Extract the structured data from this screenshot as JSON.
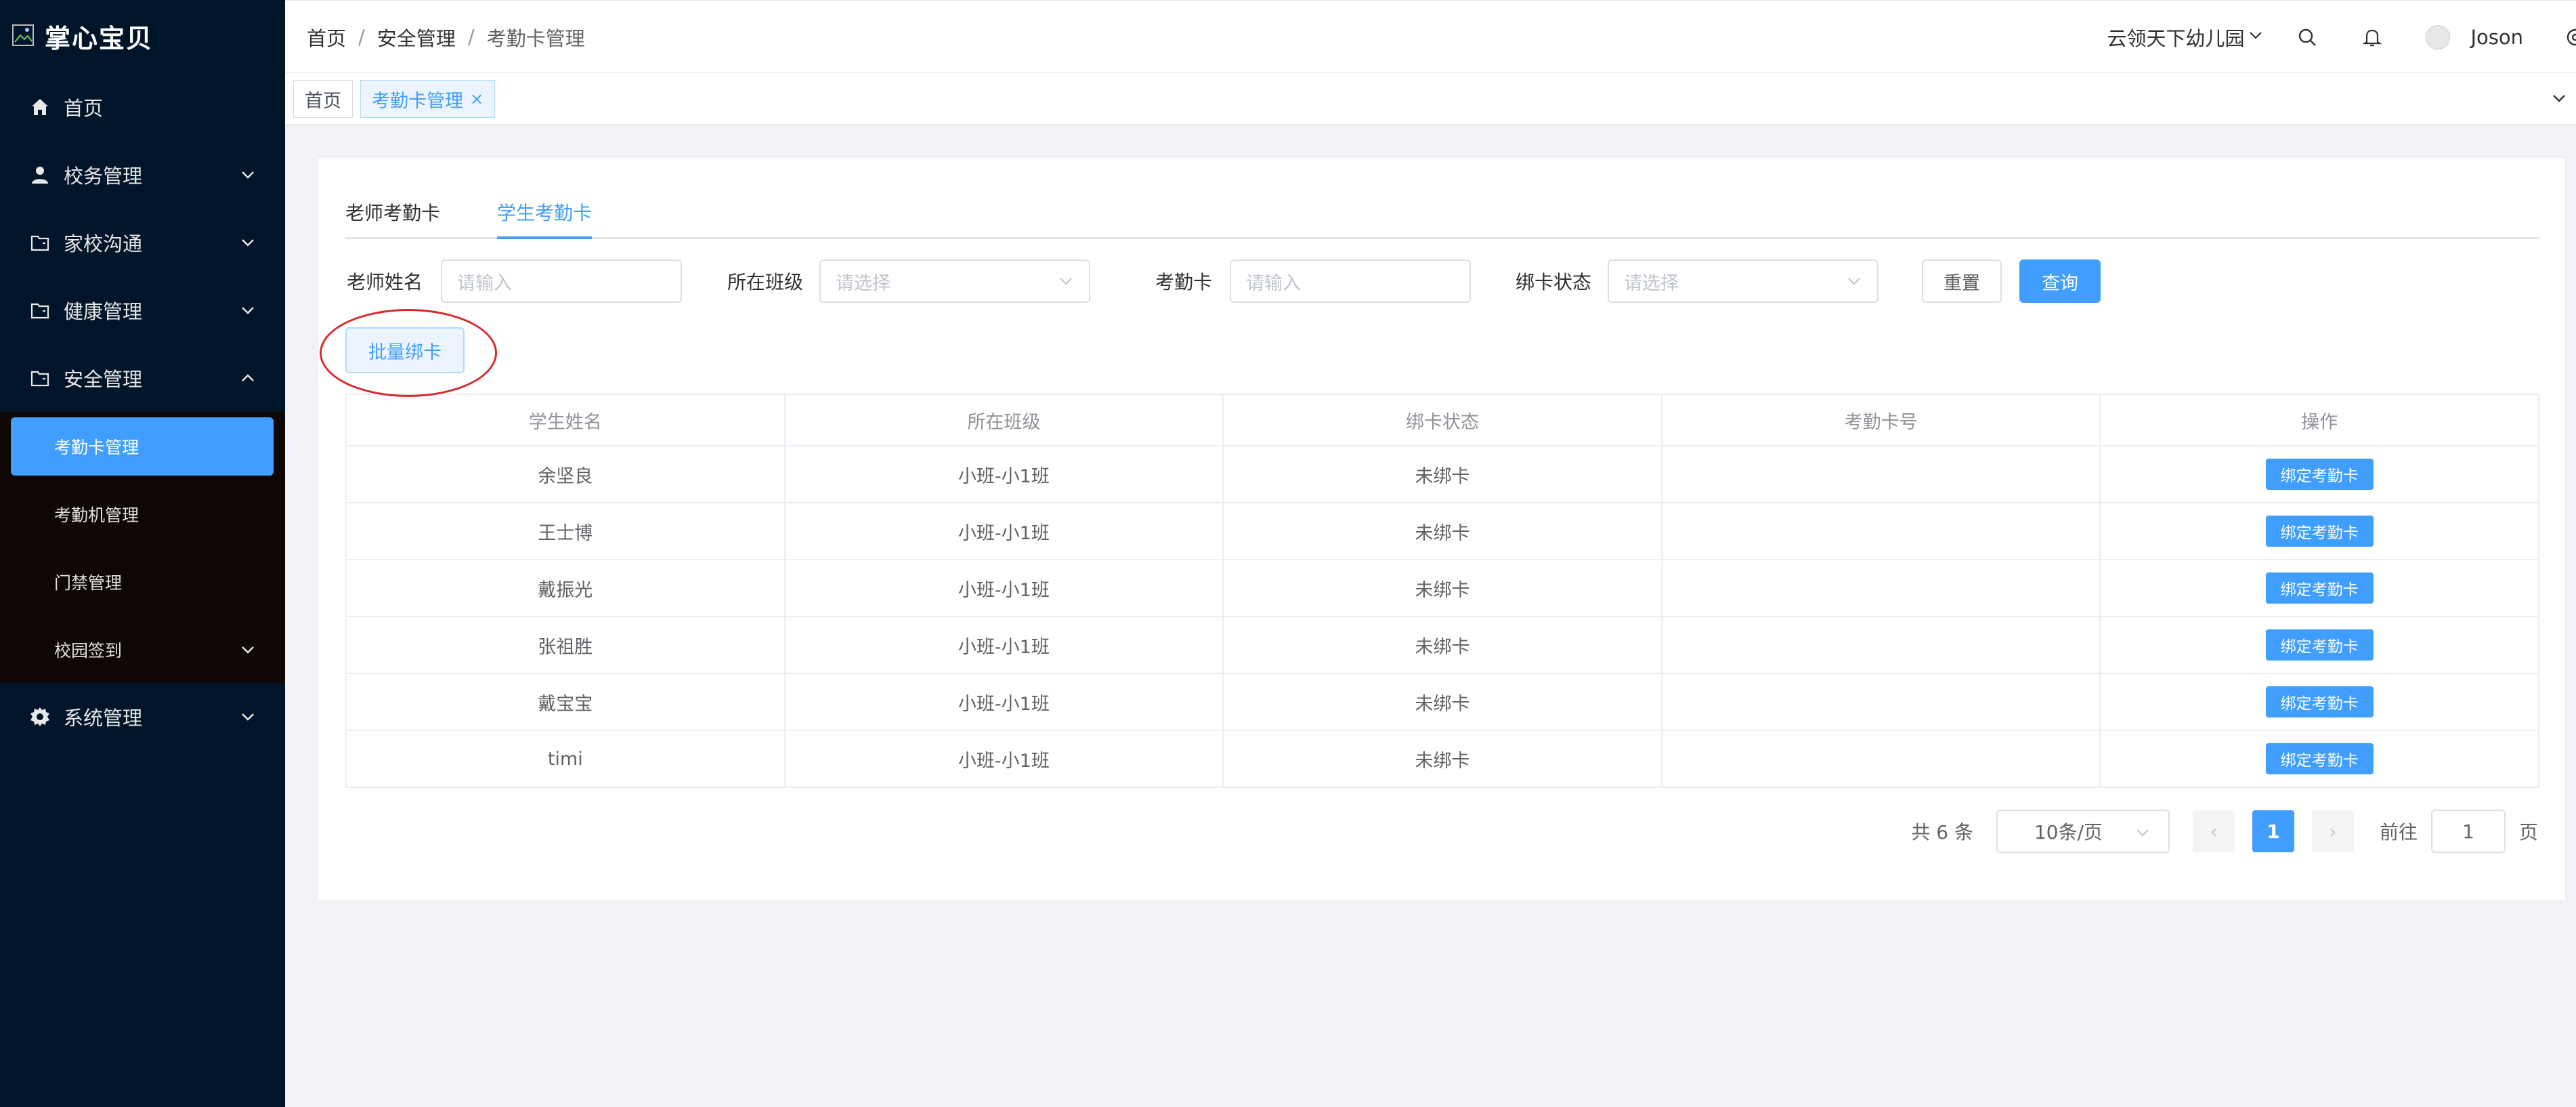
{
  "app": {
    "name": "掌心宝贝"
  },
  "sidebar": {
    "items": [
      {
        "label": "首页",
        "icon": "home-icon"
      },
      {
        "label": "校务管理",
        "icon": "user-icon"
      },
      {
        "label": "家校沟通",
        "icon": "folder-icon"
      },
      {
        "label": "健康管理",
        "icon": "folder-icon"
      },
      {
        "label": "安全管理",
        "icon": "folder-icon",
        "expanded": true
      },
      {
        "label": "系统管理",
        "icon": "gear-icon"
      }
    ],
    "security_sub": [
      {
        "label": "考勤卡管理",
        "active": true
      },
      {
        "label": "考勤机管理"
      },
      {
        "label": "门禁管理"
      },
      {
        "label": "校园签到"
      }
    ]
  },
  "breadcrumb": [
    "首页",
    "安全管理",
    "考勤卡管理"
  ],
  "header": {
    "kindergarten": "云领天下幼儿园",
    "username": "Joson"
  },
  "tags": [
    {
      "label": "首页"
    },
    {
      "label": "考勤卡管理",
      "close": "×",
      "active": true
    }
  ],
  "tabs": [
    {
      "label": "老师考勤卡"
    },
    {
      "label": "学生考勤卡",
      "active": true
    }
  ],
  "filters": {
    "teacher_name": {
      "label": "老师姓名",
      "placeholder": "请输入"
    },
    "class": {
      "label": "所在班级",
      "placeholder": "请选择"
    },
    "card": {
      "label": "考勤卡",
      "placeholder": "请输入"
    },
    "bind_status": {
      "label": "绑卡状态",
      "placeholder": "请选择"
    },
    "reset": "重置",
    "search": "查询"
  },
  "batch_bind": "批量绑卡",
  "table": {
    "headers": [
      "学生姓名",
      "所在班级",
      "绑卡状态",
      "考勤卡号",
      "操作"
    ],
    "action_label": "绑定考勤卡",
    "rows": [
      {
        "name": "余坚良",
        "class": "小班-小1班",
        "status": "未绑卡",
        "card": ""
      },
      {
        "name": "王士博",
        "class": "小班-小1班",
        "status": "未绑卡",
        "card": ""
      },
      {
        "name": "戴振光",
        "class": "小班-小1班",
        "status": "未绑卡",
        "card": ""
      },
      {
        "name": "张祖胜",
        "class": "小班-小1班",
        "status": "未绑卡",
        "card": ""
      },
      {
        "name": "戴宝宝",
        "class": "小班-小1班",
        "status": "未绑卡",
        "card": ""
      },
      {
        "name": "timi",
        "class": "小班-小1班",
        "status": "未绑卡",
        "card": ""
      }
    ]
  },
  "pagination": {
    "total": "共 6 条",
    "page_size": "10条/页",
    "prev": "‹",
    "current": "1",
    "next": "›",
    "goto_label": "前往",
    "goto_value": "1",
    "page_unit": "页"
  },
  "colors": {
    "primary": "#409eff",
    "sidebar_bg": "#001529",
    "annotation": "#d62a2a"
  }
}
